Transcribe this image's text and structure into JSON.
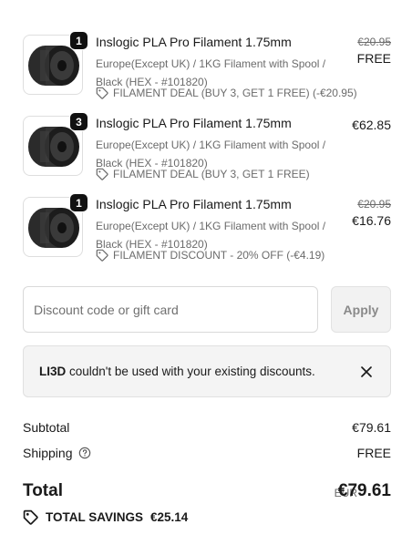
{
  "items": [
    {
      "quantity": "1",
      "name": "Inslogic PLA Pro Filament 1.75mm",
      "variant": "Europe(Except UK) / 1KG Filament with Spool / Black (HEX - #101820)",
      "discount_icon": "tag-icon",
      "discount": "FILAMENT DEAL (BUY 3, GET 1 FREE) (-€20.95)",
      "original_price": "€20.95",
      "price": "FREE"
    },
    {
      "quantity": "3",
      "name": "Inslogic PLA Pro Filament 1.75mm",
      "variant": "Europe(Except UK) / 1KG Filament with Spool / Black (HEX - #101820)",
      "discount_icon": "tag-icon",
      "discount": "FILAMENT DEAL (BUY 3, GET 1 FREE)",
      "original_price": "",
      "price": "€62.85"
    },
    {
      "quantity": "1",
      "name": "Inslogic PLA Pro Filament 1.75mm",
      "variant": "Europe(Except UK) / 1KG Filament with Spool / Black (HEX - #101820)",
      "discount_icon": "tag-icon",
      "discount": "FILAMENT DISCOUNT - 20% OFF (-€4.19)",
      "original_price": "€20.95",
      "price": "€16.76"
    }
  ],
  "discount_form": {
    "placeholder": "Discount code or gift card",
    "value": "",
    "apply_label": "Apply"
  },
  "notice": {
    "code": "LI3D",
    "message": " couldn't be used with your existing discounts.",
    "close_icon": "close-icon"
  },
  "summary": {
    "subtotal_label": "Subtotal",
    "subtotal_value": "€79.61",
    "shipping_label": "Shipping",
    "shipping_icon": "help-circle-icon",
    "shipping_value": "FREE",
    "total_label": "Total",
    "currency": "EUR",
    "total_value": "€79.61",
    "savings_icon": "tag-icon",
    "savings_label": "TOTAL SAVINGS",
    "savings_value": "€25.14"
  },
  "colors": {
    "text": "#1a1a1a",
    "muted": "#6b6b6b",
    "badge": "#111111",
    "notice_bg": "#f4f4f4"
  }
}
